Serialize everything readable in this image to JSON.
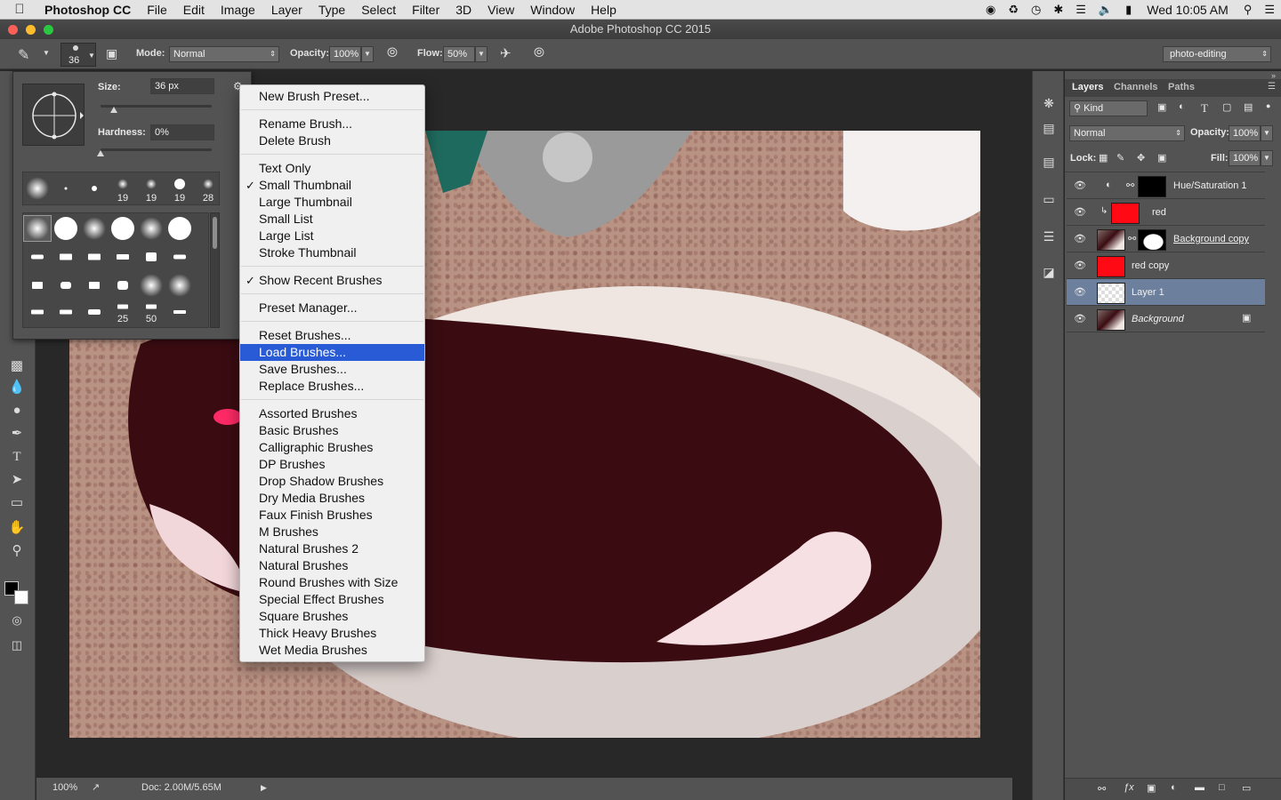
{
  "menubar": {
    "app_name": "Photoshop CC",
    "items": [
      "File",
      "Edit",
      "Image",
      "Layer",
      "Type",
      "Select",
      "Filter",
      "3D",
      "View",
      "Window",
      "Help"
    ],
    "clock": "Wed 10:05 AM"
  },
  "window": {
    "title": "Adobe Photoshop CC 2015"
  },
  "options": {
    "brush_size_label": "36",
    "mode_label": "Mode:",
    "mode_value": "Normal",
    "opacity_label": "Opacity:",
    "opacity_value": "100%",
    "flow_label": "Flow:",
    "flow_value": "50%",
    "workspace": "photo-editing"
  },
  "picker": {
    "size_label": "Size:",
    "size_value": "36 px",
    "size_fraction": 0.12,
    "hardness_label": "Hardness:",
    "hardness_value": "0%",
    "hardness_fraction": 0.0,
    "recent_numbers": [
      "19",
      "19",
      "19",
      "28"
    ],
    "grid_numbers": [
      "25",
      "50"
    ]
  },
  "menu": {
    "items": [
      {
        "label": "New Brush Preset..."
      },
      {
        "label": "Rename Brush..."
      },
      {
        "label": "Delete Brush"
      },
      {
        "label": "Text Only"
      },
      {
        "label": "Small Thumbnail",
        "checked": true
      },
      {
        "label": "Large Thumbnail"
      },
      {
        "label": "Small List"
      },
      {
        "label": "Large List"
      },
      {
        "label": "Stroke Thumbnail"
      },
      {
        "label": "Show Recent Brushes",
        "checked": true
      },
      {
        "label": "Preset Manager..."
      },
      {
        "label": "Reset Brushes..."
      },
      {
        "label": "Load Brushes...",
        "highlighted": true
      },
      {
        "label": "Save Brushes..."
      },
      {
        "label": "Replace Brushes..."
      },
      {
        "label": "Assorted Brushes"
      },
      {
        "label": "Basic Brushes"
      },
      {
        "label": "Calligraphic Brushes"
      },
      {
        "label": "DP Brushes"
      },
      {
        "label": "Drop Shadow Brushes"
      },
      {
        "label": "Dry Media Brushes"
      },
      {
        "label": "Faux Finish Brushes"
      },
      {
        "label": "M Brushes"
      },
      {
        "label": "Natural Brushes 2"
      },
      {
        "label": "Natural Brushes"
      },
      {
        "label": "Round Brushes with Size"
      },
      {
        "label": "Special Effect Brushes"
      },
      {
        "label": "Square Brushes"
      },
      {
        "label": "Thick Heavy Brushes"
      },
      {
        "label": "Wet Media Brushes"
      }
    ]
  },
  "layers_panel": {
    "tabs": [
      "Layers",
      "Channels",
      "Paths"
    ],
    "active_tab": "Layers",
    "kind_label": "Kind",
    "blend_mode": "Normal",
    "opacity_label": "Opacity:",
    "opacity_value": "100%",
    "lock_label": "Lock:",
    "fill_label": "Fill:",
    "fill_value": "100%",
    "layers": [
      {
        "name": "Hue/Saturation 1",
        "type": "adjustment"
      },
      {
        "name": "red",
        "type": "fill",
        "color": "#ff0a14",
        "clipped": true
      },
      {
        "name": "Background copy",
        "type": "masked-photo"
      },
      {
        "name": "red copy",
        "type": "fill",
        "color": "#ff0a14"
      },
      {
        "name": "Layer 1",
        "type": "transparent",
        "selected": true
      },
      {
        "name": "Background",
        "type": "photo",
        "locked": true
      }
    ]
  },
  "status": {
    "zoom": "100%",
    "doc_info": "Doc: 2.00M/5.65M"
  },
  "colors": {
    "menu_highlight": "#2a5bd7",
    "selected_layer": "#6c7f9c",
    "fill_red": "#ff0a14"
  }
}
